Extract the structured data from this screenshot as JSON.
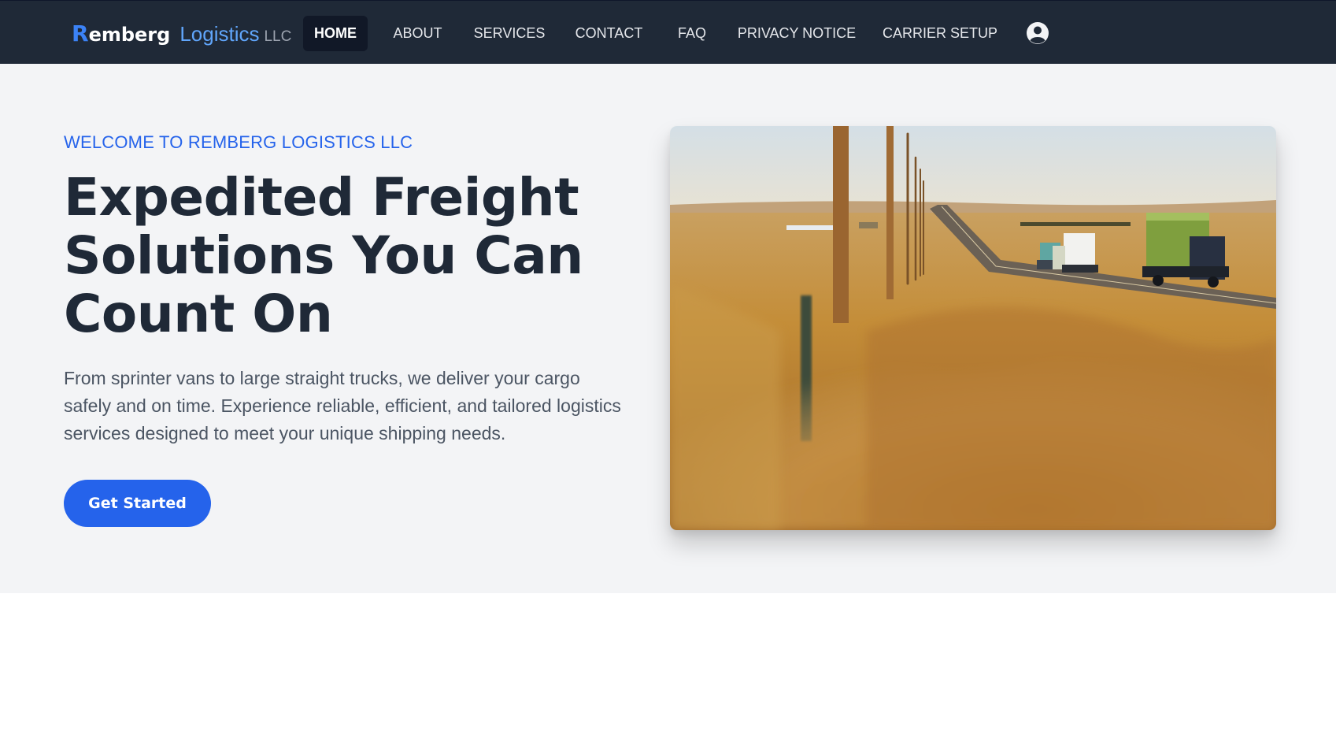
{
  "brand": {
    "initial": "R",
    "rest": "emberg",
    "logistics": "Logistics",
    "llc": "LLC"
  },
  "nav": {
    "items": [
      {
        "label": "HOME",
        "active": true
      },
      {
        "label": "ABOUT",
        "active": false
      },
      {
        "label": "SERVICES",
        "active": false
      },
      {
        "label": "CONTACT",
        "active": false
      },
      {
        "label": "FAQ",
        "active": false
      },
      {
        "label": "PRIVACY NOTICE",
        "active": false
      },
      {
        "label": "CARRIER SETUP",
        "active": false
      }
    ],
    "account_icon": "user-circle-icon"
  },
  "hero": {
    "eyebrow": "WELCOME TO REMBERG LOGISTICS LLC",
    "headline_lines": [
      "Expedited Freight",
      "Solutions You Can",
      "Count On"
    ],
    "description": "From sprinter vans to large straight trucks, we deliver your cargo safely and on time. Experience reliable, efficient, and tailored logistics services designed to meet your unique shipping needs.",
    "cta_label": "Get Started",
    "image_subject": "trucks-on-prairie-highway"
  },
  "colors": {
    "nav_bg": "#1f2937",
    "accent": "#2563eb",
    "hero_bg": "#f3f4f6",
    "heading": "#1f2937"
  }
}
